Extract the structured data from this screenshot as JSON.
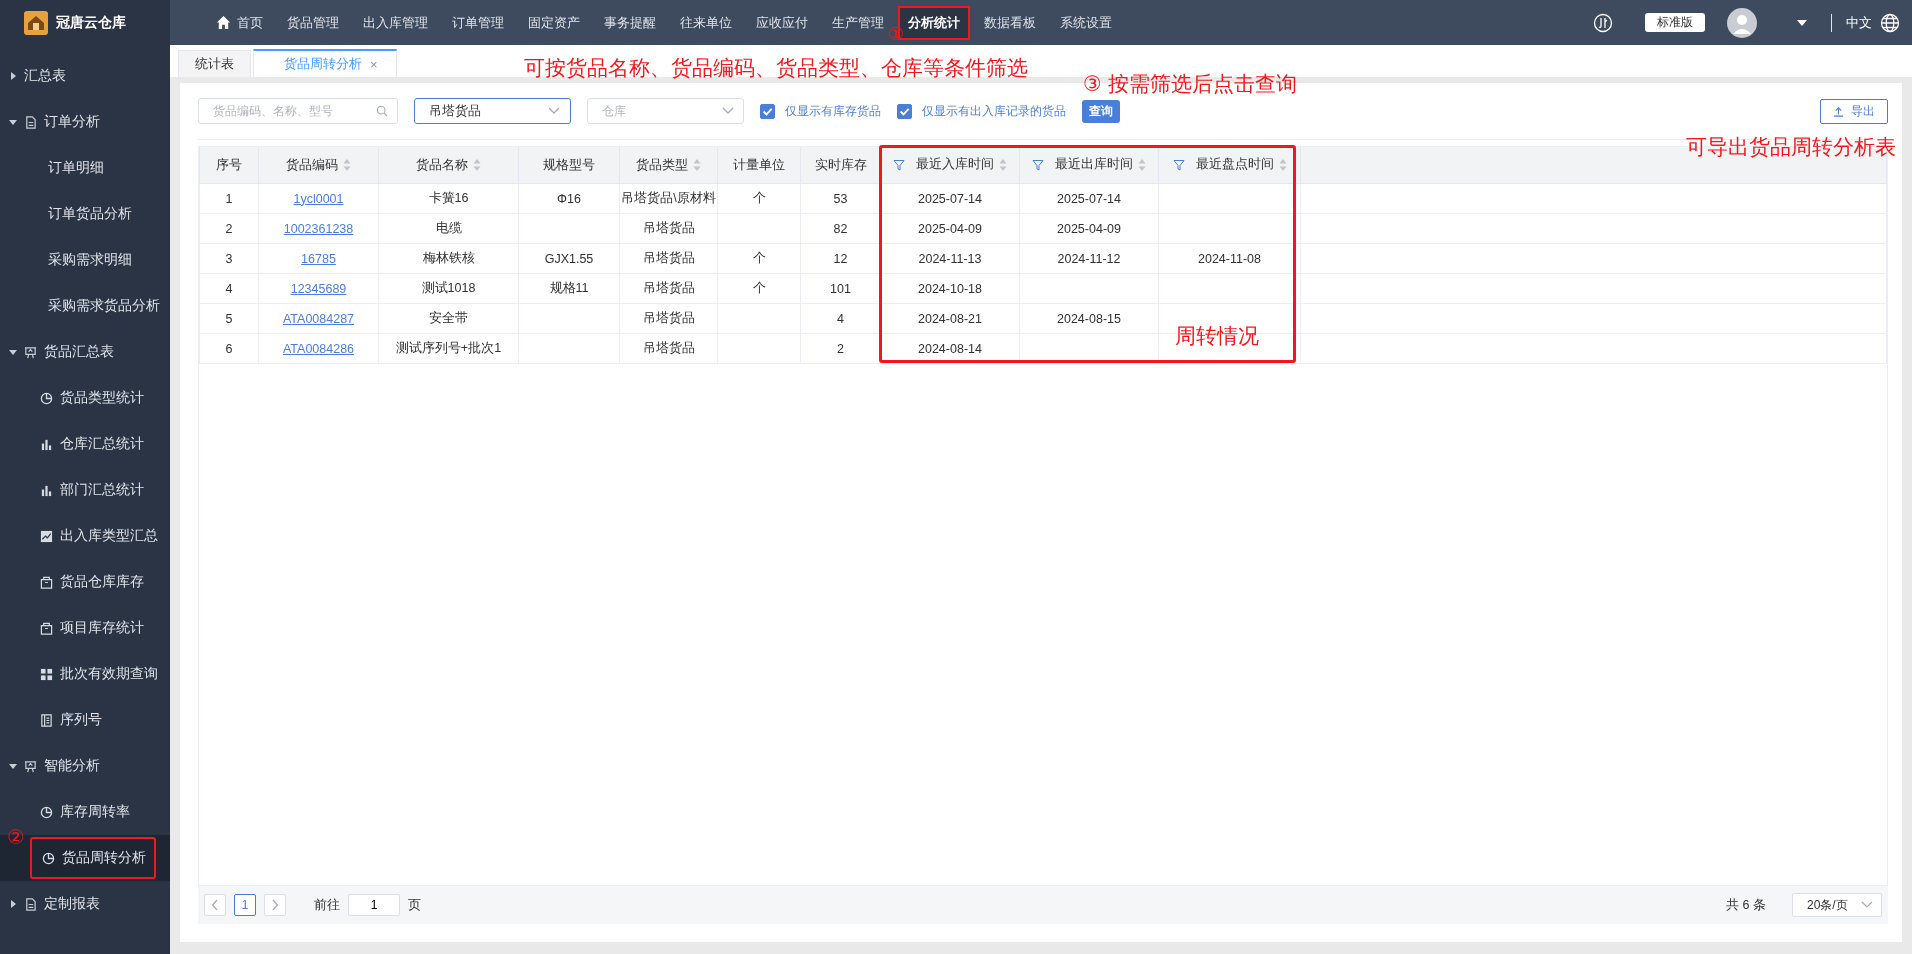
{
  "app": {
    "name": "冠唐云仓库"
  },
  "nav": [
    {
      "label": "首页",
      "selected": false,
      "outlined": false
    },
    {
      "label": "货品管理",
      "selected": false,
      "outlined": false
    },
    {
      "label": "出入库管理",
      "selected": false,
      "outlined": false
    },
    {
      "label": "订单管理",
      "selected": false,
      "outlined": false
    },
    {
      "label": "固定资产",
      "selected": false,
      "outlined": false
    },
    {
      "label": "事务提醒",
      "selected": false,
      "outlined": false
    },
    {
      "label": "往来单位",
      "selected": false,
      "outlined": false
    },
    {
      "label": "应收应付",
      "selected": false,
      "outlined": false
    },
    {
      "label": "生产管理",
      "selected": false,
      "outlined": false
    },
    {
      "label": "分析统计",
      "selected": true,
      "outlined": true,
      "callout": "①"
    },
    {
      "label": "数据看板",
      "selected": false,
      "outlined": false
    },
    {
      "label": "系统设置",
      "selected": false,
      "outlined": false
    }
  ],
  "header_right": {
    "edition": "标准版",
    "language": "中文"
  },
  "sidebar": {
    "items": [
      {
        "label": "汇总表",
        "expanded": false
      },
      {
        "label": "订单分析",
        "expanded": true,
        "children": [
          {
            "label": "订单明细",
            "selected": false,
            "outlined": false
          },
          {
            "label": "订单货品分析",
            "selected": false,
            "outlined": false
          },
          {
            "label": "采购需求明细",
            "selected": false,
            "outlined": false
          },
          {
            "label": "采购需求货品分析",
            "selected": false,
            "outlined": false
          }
        ]
      },
      {
        "label": "货品汇总表",
        "expanded": true,
        "children": [
          {
            "label": "货品类型统计",
            "selected": false,
            "outlined": false
          },
          {
            "label": "仓库汇总统计",
            "selected": false,
            "outlined": false
          },
          {
            "label": "部门汇总统计",
            "selected": false,
            "outlined": false
          },
          {
            "label": "出入库类型汇总",
            "selected": false,
            "outlined": false
          },
          {
            "label": "货品仓库库存",
            "selected": false,
            "outlined": false
          },
          {
            "label": "项目库存统计",
            "selected": false,
            "outlined": false
          },
          {
            "label": "批次有效期查询",
            "selected": false,
            "outlined": false
          },
          {
            "label": "序列号",
            "selected": false,
            "outlined": false
          }
        ]
      },
      {
        "label": "智能分析",
        "expanded": true,
        "children": [
          {
            "label": "库存周转率",
            "selected": false,
            "outlined": false
          },
          {
            "label": "货品周转分析",
            "selected": true,
            "outlined": true,
            "callout": "②"
          }
        ]
      },
      {
        "label": "定制报表",
        "expanded": false
      }
    ]
  },
  "tabs": [
    {
      "label": "统计表",
      "selected": false
    },
    {
      "label": "货品周转分析",
      "selected": true,
      "close": "×"
    }
  ],
  "filters": {
    "search": {
      "placeholder": "货品编码、名称、型号"
    },
    "type_select": {
      "value": "吊塔货品"
    },
    "warehouse_select": {
      "placeholder": "仓库"
    },
    "checkboxes": [
      {
        "label": "仅显示有库存货品",
        "checked": true
      },
      {
        "label": "仅显示有出入库记录的货品",
        "checked": true
      }
    ],
    "query_button": "查询",
    "export_button": "导出"
  },
  "table": {
    "columns": [
      {
        "label": "序号",
        "kind": "text",
        "sortable": false,
        "filterable": false
      },
      {
        "label": "货品编码",
        "kind": "link",
        "sortable": true,
        "filterable": false
      },
      {
        "label": "货品名称",
        "kind": "text",
        "sortable": true,
        "filterable": false
      },
      {
        "label": "规格型号",
        "kind": "text",
        "sortable": false,
        "filterable": false
      },
      {
        "label": "货品类型",
        "kind": "text",
        "sortable": true,
        "filterable": false
      },
      {
        "label": "计量单位",
        "kind": "text",
        "sortable": false,
        "filterable": false
      },
      {
        "label": "实时库存",
        "kind": "text",
        "sortable": false,
        "filterable": false
      },
      {
        "label": "最近入库时间",
        "kind": "text",
        "sortable": true,
        "filterable": true
      },
      {
        "label": "最近出库时间",
        "kind": "text",
        "sortable": true,
        "filterable": true
      },
      {
        "label": "最近盘点时间",
        "kind": "text",
        "sortable": true,
        "filterable": true
      }
    ],
    "rows": [
      [
        "1",
        "1ycl0001",
        "卡簧16",
        "Φ16",
        "吊塔货品\\原材料",
        "个",
        "53",
        "2025-07-14",
        "2025-07-14",
        ""
      ],
      [
        "2",
        "1002361238",
        "电缆",
        "",
        "吊塔货品",
        "",
        "82",
        "2025-04-09",
        "2025-04-09",
        ""
      ],
      [
        "3",
        "16785",
        "梅林铁核",
        "GJX1.55",
        "吊塔货品",
        "个",
        "12",
        "2024-11-13",
        "2024-11-12",
        "2024-11-08"
      ],
      [
        "4",
        "12345689",
        "测试1018",
        "规格11",
        "吊塔货品",
        "个",
        "101",
        "2024-10-18",
        "",
        ""
      ],
      [
        "5",
        "ATA0084287",
        "安全带",
        "",
        "吊塔货品",
        "",
        "4",
        "2024-08-21",
        "2024-08-15",
        ""
      ],
      [
        "6",
        "ATA0084286",
        "测试序列号+批次1",
        "",
        "吊塔货品",
        "",
        "2",
        "2024-08-14",
        "",
        ""
      ]
    ]
  },
  "pagination": {
    "pages": [
      {
        "label": "1",
        "selected": true
      }
    ],
    "goto_label": "前往",
    "goto_value": "1",
    "page_suffix": "页",
    "total": "共 6 条",
    "page_size": "20条/页"
  },
  "annotations": [
    {
      "kind": "note",
      "text": "可按货品名称、货品编码、货品类型、仓库等条件筛选"
    },
    {
      "kind": "note",
      "text": "③ 按需筛选后点击查询"
    },
    {
      "kind": "note",
      "text": "可导出货品周转分析表"
    },
    {
      "kind": "frame",
      "text": "周转情况"
    }
  ]
}
